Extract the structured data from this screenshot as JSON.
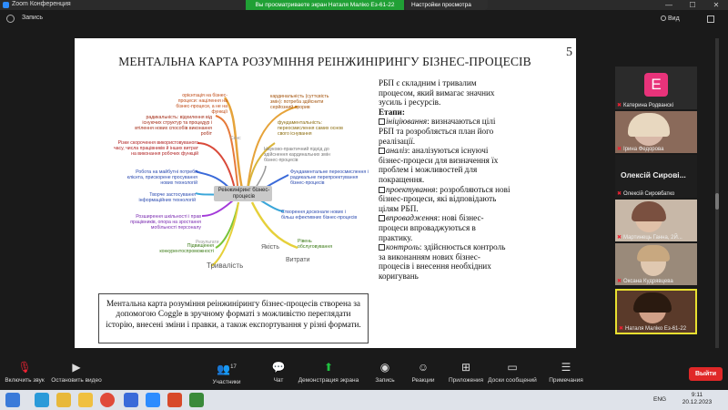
{
  "window": {
    "app_title": "Zoom Конференция",
    "share_banner": "Вы просматриваете экран Наталя Маліко Ез-61-22",
    "view_settings": "Настройки просмотра",
    "recording_label": "Запись",
    "view_label": "Вид"
  },
  "slide": {
    "number": "5",
    "title": "МЕНТАЛЬНА КАРТА РОЗУМІННЯ РЕІНЖИНІРИНГУ БІЗНЕС-ПРОЦЕСІВ",
    "mindmap": {
      "center": "Реінжиніринг бізнес-процесів",
      "branches": [
        {
          "id": "orient",
          "text": "орієнтація на бізнес-процеси: націлення на бізнес-процеси, а не на функції"
        },
        {
          "id": "radical",
          "text": "радикальність: відхилення від існуючих структур та процедур і втілення нових способів виконання робіт"
        },
        {
          "id": "fast",
          "text": "Різке скорочення використовуваного часу, числа працівників й інших витрат на виконання робочих функцій"
        },
        {
          "id": "clients",
          "text": "Робота на майбутні потреби клієнта, прискорене просування нових технологій"
        },
        {
          "id": "it",
          "text": "Творче застосування інформаційних технологій"
        },
        {
          "id": "emp",
          "text": "Розширення шкільності і прав працівників, опора на зростання мобільності персоналу"
        },
        {
          "id": "compet",
          "text": "Підвищення конкурентоспроможності"
        },
        {
          "id": "cardinal",
          "text": "кардинальність (суттєвість змін): потреба здійснити серйозний прорив"
        },
        {
          "id": "fund",
          "text": "фундаментальність: переосмислення самих основ свого існування"
        },
        {
          "id": "scientific",
          "text": "Науково-практичний підхід до здійснення кардинальних змін бізнес-процесів"
        },
        {
          "id": "rethink",
          "text": "Фундаментальне переосмислення і радикальне перепроектування бізнес-процесів"
        },
        {
          "id": "create",
          "text": "Створення досконале нових і більш ефективних бізнес-процесів"
        },
        {
          "id": "service",
          "text": "Рівень обслуговування"
        }
      ],
      "small_labels": {
        "sense": "Сенс",
        "results": "Результати",
        "quality": "Якість",
        "costs": "Витрати",
        "duration": "Тривалість"
      }
    },
    "right_text": {
      "intro": "РБП є складним і тривалим процесом, який вимагає значних зусиль і ресурсів.",
      "stages_heading": "Етапи:",
      "stages": [
        {
          "term": "ініціювання",
          "text": ": визначаються цілі РБП та розробляється план його реалізації."
        },
        {
          "term": "аналіз",
          "text": ": аналізуються існуючі бізнес-процеси для визначення їх проблем і можливостей для покращення."
        },
        {
          "term": "проектування",
          "text": ": розробляються нові бізнес-процеси, які відповідають цілям РБП."
        },
        {
          "term": "впровадження",
          "text": ": нові бізнес-процеси впроваджуються в практику."
        },
        {
          "term": "контроль",
          "text": ": здійснюється контроль за виконанням нових бізнес-процесів і внесення необхідних коригувань"
        }
      ]
    },
    "caption": "Ментальна карта розуміння реінжинірингу бізнес-процесів створена за допомогою Coggle в зручному форматі з можливістю переглядати історію, внесені зміни і правки, а також експортування у різні формати."
  },
  "participants": [
    {
      "name": "Катерина Родванскі",
      "initial": "E",
      "color": "#e8337a",
      "muted": true
    },
    {
      "name": "Ірина Федорова",
      "muted": true
    },
    {
      "name": "Олексій Сировбатко",
      "muted": true,
      "big_name": "Олексій Сирові..."
    },
    {
      "name": "Мартинець Ганна, 2Й...",
      "muted": true
    },
    {
      "name": "Оксана Кудрявцева",
      "muted": true
    },
    {
      "name": "Наталя Маліко Ез-61-22",
      "muted": true,
      "active": true
    }
  ],
  "toolbar": {
    "mute": "Включить звук",
    "video": "Остановить видео",
    "participants": "Участники",
    "participants_count": "17",
    "chat": "Чат",
    "share": "Демонстрация экрана",
    "record": "Запись",
    "reactions": "Реакции",
    "apps": "Приложения",
    "whiteboard": "Доски сообщений",
    "notes": "Примечания",
    "leave": "Выйти"
  },
  "taskbar": {
    "lang": "ENG",
    "time": "9:11",
    "date": "20.12.2023"
  },
  "colors": {
    "share_green": "#20a035",
    "leave_red": "#e02828",
    "participant_accent": "#e8337a"
  }
}
